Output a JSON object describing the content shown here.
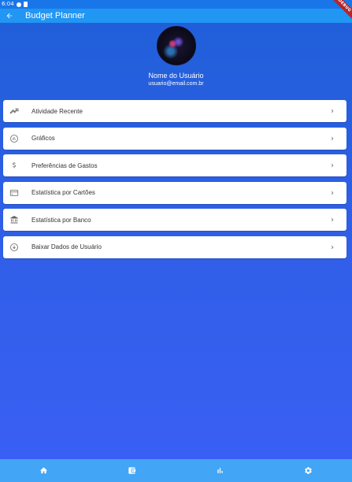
{
  "status_bar": {
    "time": "6:04"
  },
  "app_bar": {
    "title": "Budget Planner",
    "back_icon": "arrow-left-icon"
  },
  "debug_banner": {
    "label": "DEBUG"
  },
  "profile": {
    "name": "Nome do Usuário",
    "email": "usuario@email.com.br"
  },
  "menu": {
    "items": [
      {
        "label": "Atividade Recente",
        "icon": "trending-up-icon"
      },
      {
        "label": "Gráficos",
        "icon": "chart-circle-icon"
      },
      {
        "label": "Preferências de Gastos",
        "icon": "dollar-icon"
      },
      {
        "label": "Estatística por Cartões",
        "icon": "credit-card-icon"
      },
      {
        "label": "Estatística por Banco",
        "icon": "bank-icon"
      },
      {
        "label": "Baixar Dados de Usuário",
        "icon": "download-circle-icon"
      }
    ],
    "chevron_icon": "chevron-right-icon"
  },
  "bottom_nav": {
    "items": [
      {
        "icon": "home-icon"
      },
      {
        "icon": "wallet-icon"
      },
      {
        "icon": "bar-chart-icon"
      },
      {
        "icon": "gear-icon"
      }
    ]
  },
  "colors": {
    "app_bar": "#2196f3",
    "status_bar": "#1976e8",
    "bottom_nav": "#42a5f5",
    "background_top": "#1f5fd8",
    "background_bottom": "#3a5ff5",
    "debug_ribbon": "#b3262d"
  }
}
